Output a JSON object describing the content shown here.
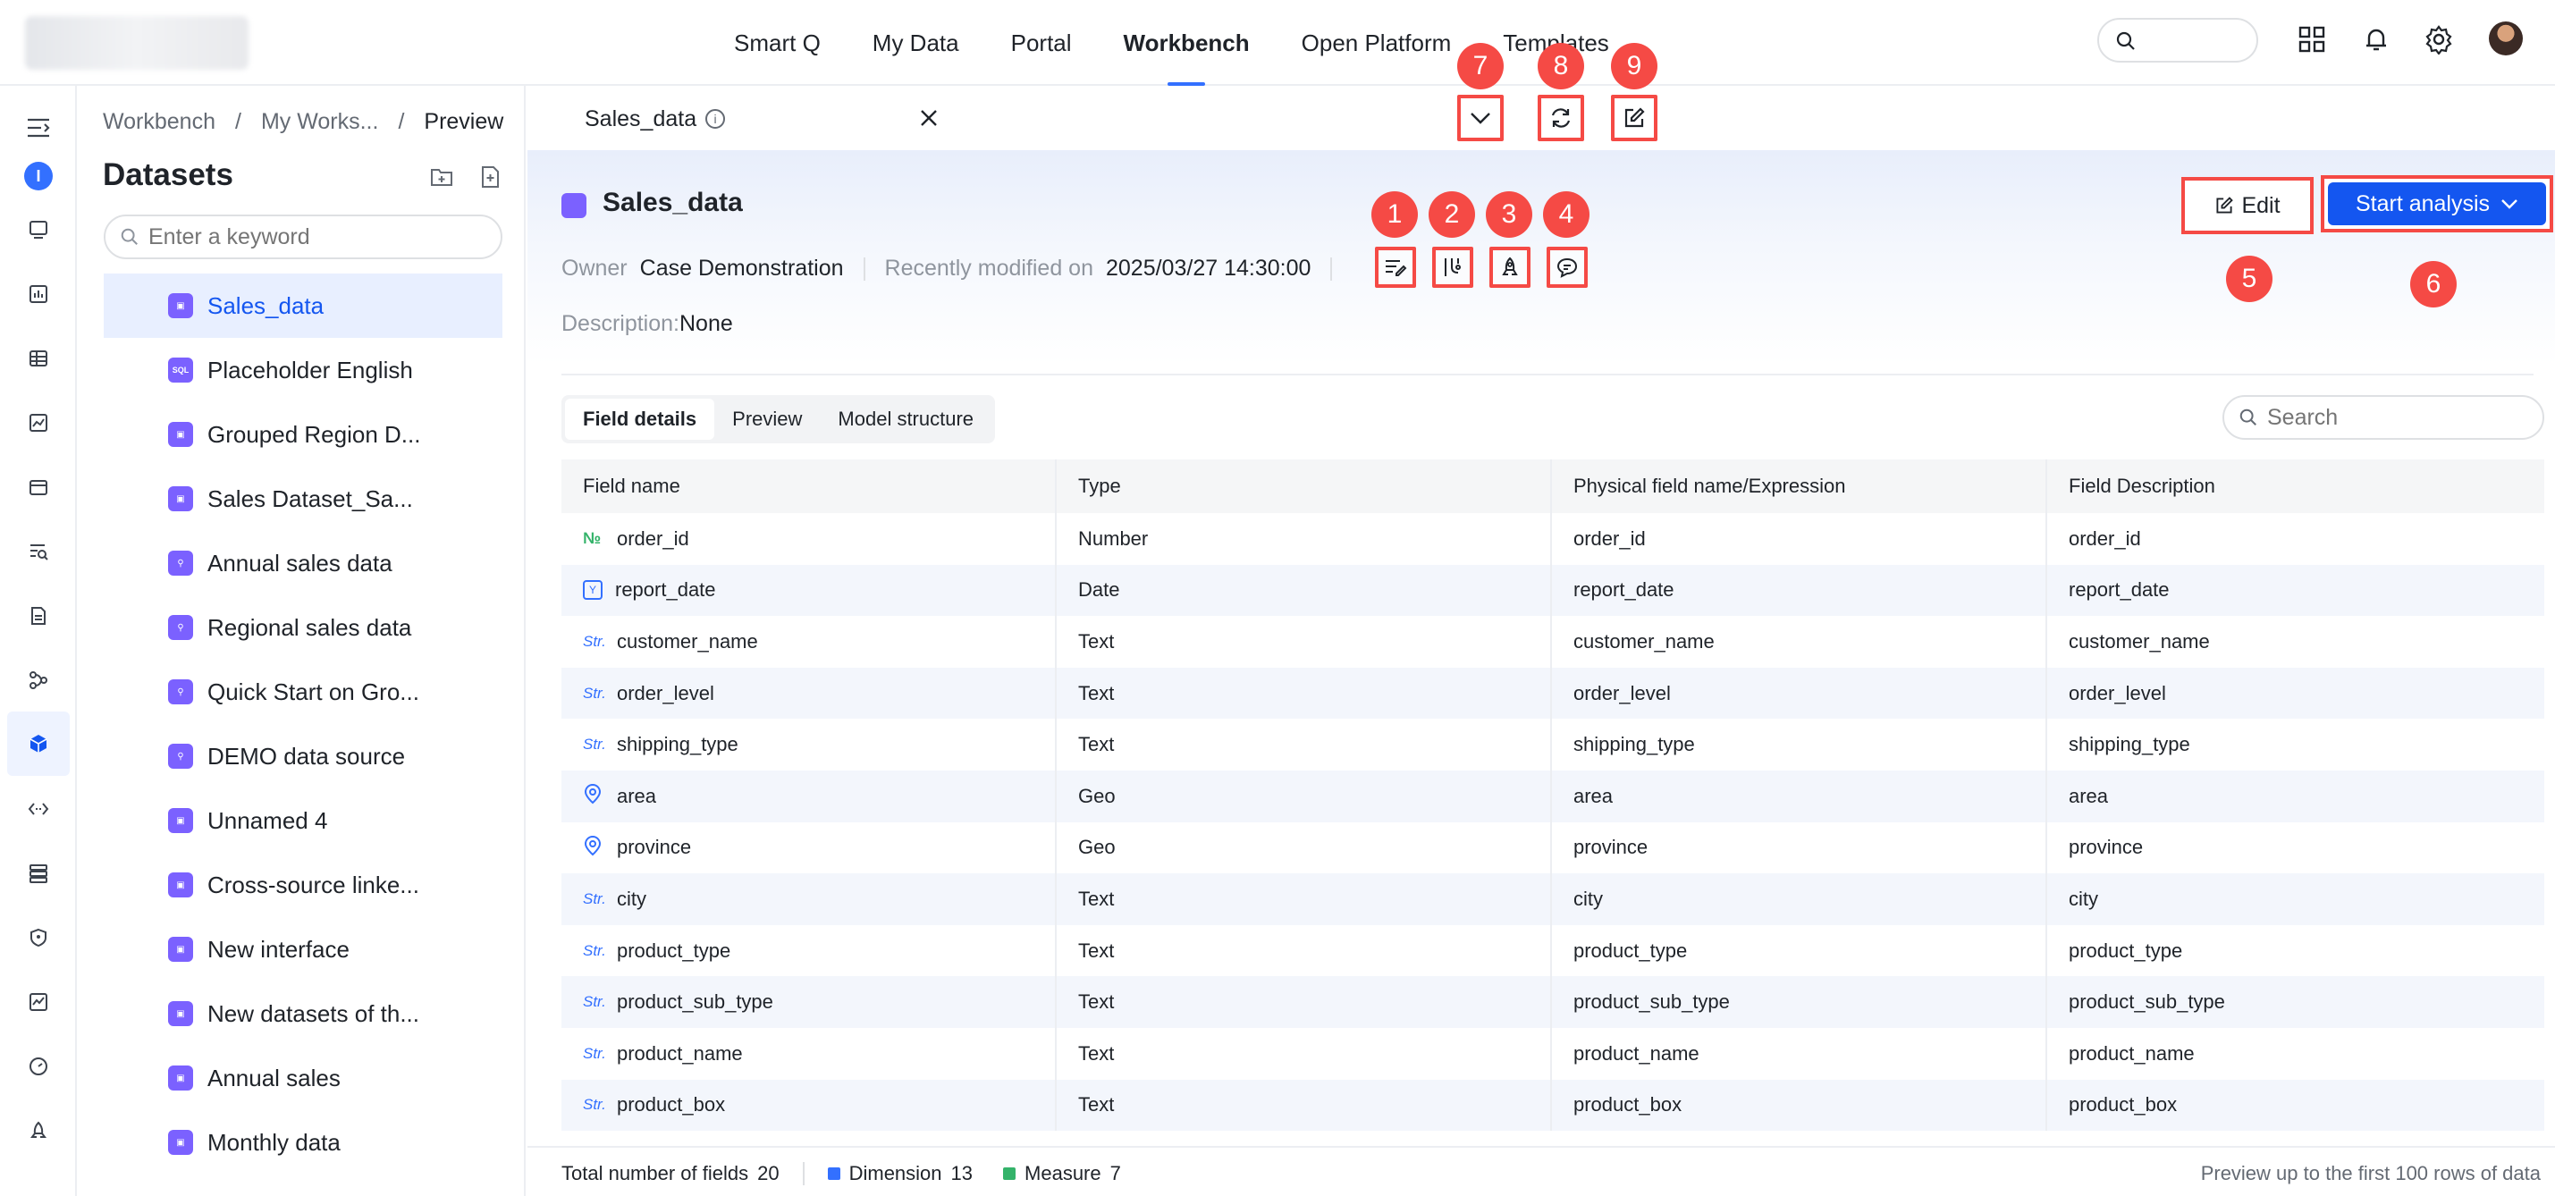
{
  "nav": {
    "items": [
      "Smart Q",
      "My Data",
      "Portal",
      "Workbench",
      "Open Platform",
      "Templates"
    ],
    "active": "Workbench"
  },
  "rail": {
    "badge": "I"
  },
  "datasets_panel": {
    "breadcrumb": [
      "Workbench",
      "My Works...",
      "Preview"
    ],
    "title": "Datasets",
    "search_placeholder": "Enter a keyword",
    "items": [
      {
        "label": "Sales_data",
        "icon": "cube-icon",
        "active": true
      },
      {
        "label": "Placeholder English",
        "icon": "sql-icon"
      },
      {
        "label": "Grouped Region D...",
        "icon": "cube-icon"
      },
      {
        "label": "Sales Dataset_Sa...",
        "icon": "cube-icon"
      },
      {
        "label": "Annual sales data",
        "icon": "link-icon"
      },
      {
        "label": "Regional sales data",
        "icon": "link-icon"
      },
      {
        "label": "Quick Start on Gro...",
        "icon": "link-icon"
      },
      {
        "label": "DEMO data source",
        "icon": "link-icon"
      },
      {
        "label": "Unnamed 4",
        "icon": "cube-icon"
      },
      {
        "label": "Cross-source linke...",
        "icon": "cube-icon"
      },
      {
        "label": "New interface",
        "icon": "cube-icon"
      },
      {
        "label": "New datasets of th...",
        "icon": "cube-icon"
      },
      {
        "label": "Annual sales",
        "icon": "cube-icon"
      },
      {
        "label": "Monthly data",
        "icon": "cube-icon"
      }
    ]
  },
  "file_tab": {
    "label": "Sales_data"
  },
  "header": {
    "title": "Sales_data",
    "owner_label": "Owner",
    "owner": "Case Demonstration",
    "modified_label": "Recently modified on",
    "modified": "2025/03/27 14:30:00",
    "description_label": "Description:",
    "description": "None",
    "edit_label": "Edit",
    "start_label": "Start analysis"
  },
  "callouts": [
    "1",
    "2",
    "3",
    "4",
    "5",
    "6",
    "7",
    "8",
    "9"
  ],
  "subtabs": [
    "Field details",
    "Preview",
    "Model structure"
  ],
  "table_search_placeholder": "Search",
  "table": {
    "columns": [
      "Field name",
      "Type",
      "Physical field name/Expression",
      "Field Description"
    ],
    "rows": [
      {
        "kind": "num",
        "kind_label": "№",
        "name": "order_id",
        "type": "Number",
        "physical": "order_id",
        "desc": "order_id"
      },
      {
        "kind": "date",
        "kind_label": "Y",
        "name": "report_date",
        "type": "Date",
        "physical": "report_date",
        "desc": "report_date"
      },
      {
        "kind": "str",
        "kind_label": "Str.",
        "name": "customer_name",
        "type": "Text",
        "physical": "customer_name",
        "desc": "customer_name"
      },
      {
        "kind": "str",
        "kind_label": "Str.",
        "name": "order_level",
        "type": "Text",
        "physical": "order_level",
        "desc": "order_level"
      },
      {
        "kind": "str",
        "kind_label": "Str.",
        "name": "shipping_type",
        "type": "Text",
        "physical": "shipping_type",
        "desc": "shipping_type"
      },
      {
        "kind": "geo",
        "kind_label": "",
        "name": "area",
        "type": "Geo",
        "physical": "area",
        "desc": "area"
      },
      {
        "kind": "geo",
        "kind_label": "",
        "name": "province",
        "type": "Geo",
        "physical": "province",
        "desc": "province"
      },
      {
        "kind": "str",
        "kind_label": "Str.",
        "name": "city",
        "type": "Text",
        "physical": "city",
        "desc": "city"
      },
      {
        "kind": "str",
        "kind_label": "Str.",
        "name": "product_type",
        "type": "Text",
        "physical": "product_type",
        "desc": "product_type"
      },
      {
        "kind": "str",
        "kind_label": "Str.",
        "name": "product_sub_type",
        "type": "Text",
        "physical": "product_sub_type",
        "desc": "product_sub_type"
      },
      {
        "kind": "str",
        "kind_label": "Str.",
        "name": "product_name",
        "type": "Text",
        "physical": "product_name",
        "desc": "product_name"
      },
      {
        "kind": "str",
        "kind_label": "Str.",
        "name": "product_box",
        "type": "Text",
        "physical": "product_box",
        "desc": "product_box"
      }
    ]
  },
  "footer": {
    "total_label": "Total number of fields",
    "total": "20",
    "dimension_label": "Dimension",
    "dimension": "13",
    "measure_label": "Measure",
    "measure": "7",
    "note": "Preview up to the first 100 rows of data"
  },
  "colors": {
    "accent": "#1456f0",
    "callout": "#f54a45",
    "dimension": "#3370ff",
    "measure": "#34b36a",
    "dataset_icon": "#7b61ff"
  }
}
